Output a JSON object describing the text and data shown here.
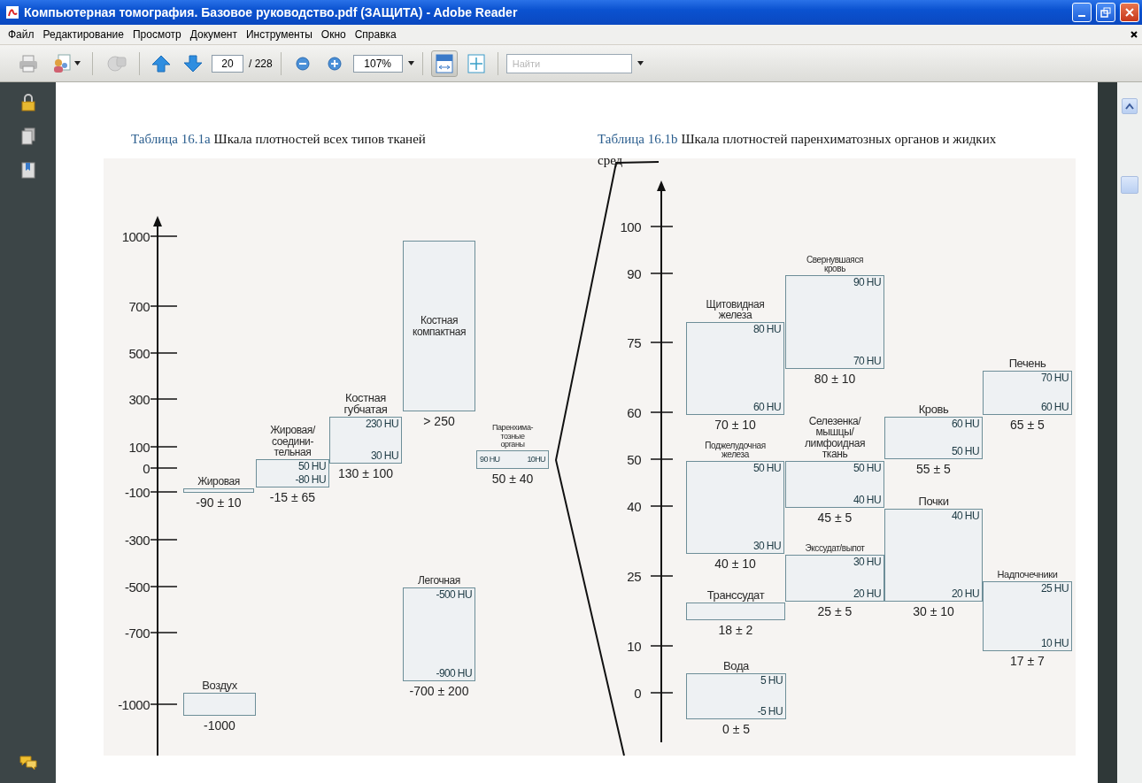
{
  "window": {
    "title": "Компьютерная томография. Базовое руководство.pdf (ЗАЩИТА) - Adobe Reader"
  },
  "menu": [
    "Файл",
    "Редактирование",
    "Просмотр",
    "Документ",
    "Инструменты",
    "Окно",
    "Справка"
  ],
  "toolbar": {
    "page": "20",
    "page_total": "/ 228",
    "zoom": "107%",
    "fit_width": {
      "selected": true
    },
    "fit_page": {
      "selected": false
    },
    "search": {
      "placeholder": "Найти"
    }
  },
  "document": {
    "tables": [
      {
        "number": "Таблица 16.1a",
        "title": "Шкала плотностей всех типов тканей",
        "axis_ticks": [
          "1000",
          "700",
          "500",
          "300",
          "100",
          "0",
          "-100",
          "-300",
          "-500",
          "-700",
          "-1000"
        ],
        "blocks": [
          {
            "kind": "plain",
            "label": "Жировая",
            "caption": "-90 ± 10"
          },
          {
            "kind": "range",
            "label": "Жировая/\nсоедини-\nтельная",
            "top": "50 HU",
            "bottom": "-80 HU",
            "caption": "-15 ± 65"
          },
          {
            "kind": "range",
            "label": "Костная\nгубчатая",
            "top": "230 HU",
            "bottom": "30 HU",
            "caption": "130 ± 100"
          },
          {
            "kind": "inner",
            "label": "Костная\nкомпактная",
            "caption": "> 250"
          },
          {
            "kind": "inline",
            "label": "Паренхима-\nтозные\nорганы",
            "top": "90 HU",
            "bottom": "10HU",
            "caption": "50 ± 40"
          },
          {
            "kind": "range",
            "label": "Легочная",
            "top": "-500 HU",
            "bottom": "-900 HU",
            "caption": "-700 ± 200"
          },
          {
            "kind": "plain",
            "label": "Воздух",
            "caption": "-1000"
          }
        ]
      },
      {
        "number": "Таблица 16.1b",
        "title": "Шкала плотностей паренхиматозных органов и жидких сред",
        "axis_ticks": [
          "100",
          "90",
          "75",
          "60",
          "50",
          "40",
          "25",
          "10",
          "0"
        ],
        "blocks": [
          {
            "kind": "range",
            "label": "Щитовидная\nжелеза",
            "top": "80 HU",
            "bottom": "60 HU",
            "caption": "70 ± 10"
          },
          {
            "kind": "range",
            "label": "Свернувшаяся\nкровь",
            "top": "90 HU",
            "bottom": "70 HU",
            "caption": "80 ± 10"
          },
          {
            "kind": "range",
            "label": "Печень",
            "top": "70 HU",
            "bottom": "60 HU",
            "caption": "65 ± 5"
          },
          {
            "kind": "range",
            "label": "Кровь",
            "top": "60 HU",
            "bottom": "50 HU",
            "caption": "55 ± 5"
          },
          {
            "kind": "range",
            "label": "Поджелудочная\nжелеза",
            "top": "50 HU",
            "bottom": "30 HU",
            "caption": "40 ± 10"
          },
          {
            "kind": "range",
            "label": "Селезенка/\nмышцы/\nлимфоидная\nткань",
            "top": "50 HU",
            "bottom": "40 HU",
            "caption": "45 ± 5"
          },
          {
            "kind": "range",
            "label": "Экссудат/выпот",
            "top": "30 HU",
            "bottom": "20 HU",
            "caption": "25 ± 5"
          },
          {
            "kind": "range",
            "label": "Почки",
            "top": "40 HU",
            "bottom": "20 HU",
            "caption": "30 ± 10"
          },
          {
            "kind": "plain",
            "label": "Транссудат",
            "caption": "18 ± 2"
          },
          {
            "kind": "range",
            "label": "Надпочечники",
            "top": "25 HU",
            "bottom": "10 HU",
            "caption": "17 ± 7"
          },
          {
            "kind": "range",
            "label": "Вода",
            "top": "5 HU",
            "bottom": "-5 HU",
            "caption": "0 ± 5"
          }
        ]
      }
    ]
  }
}
